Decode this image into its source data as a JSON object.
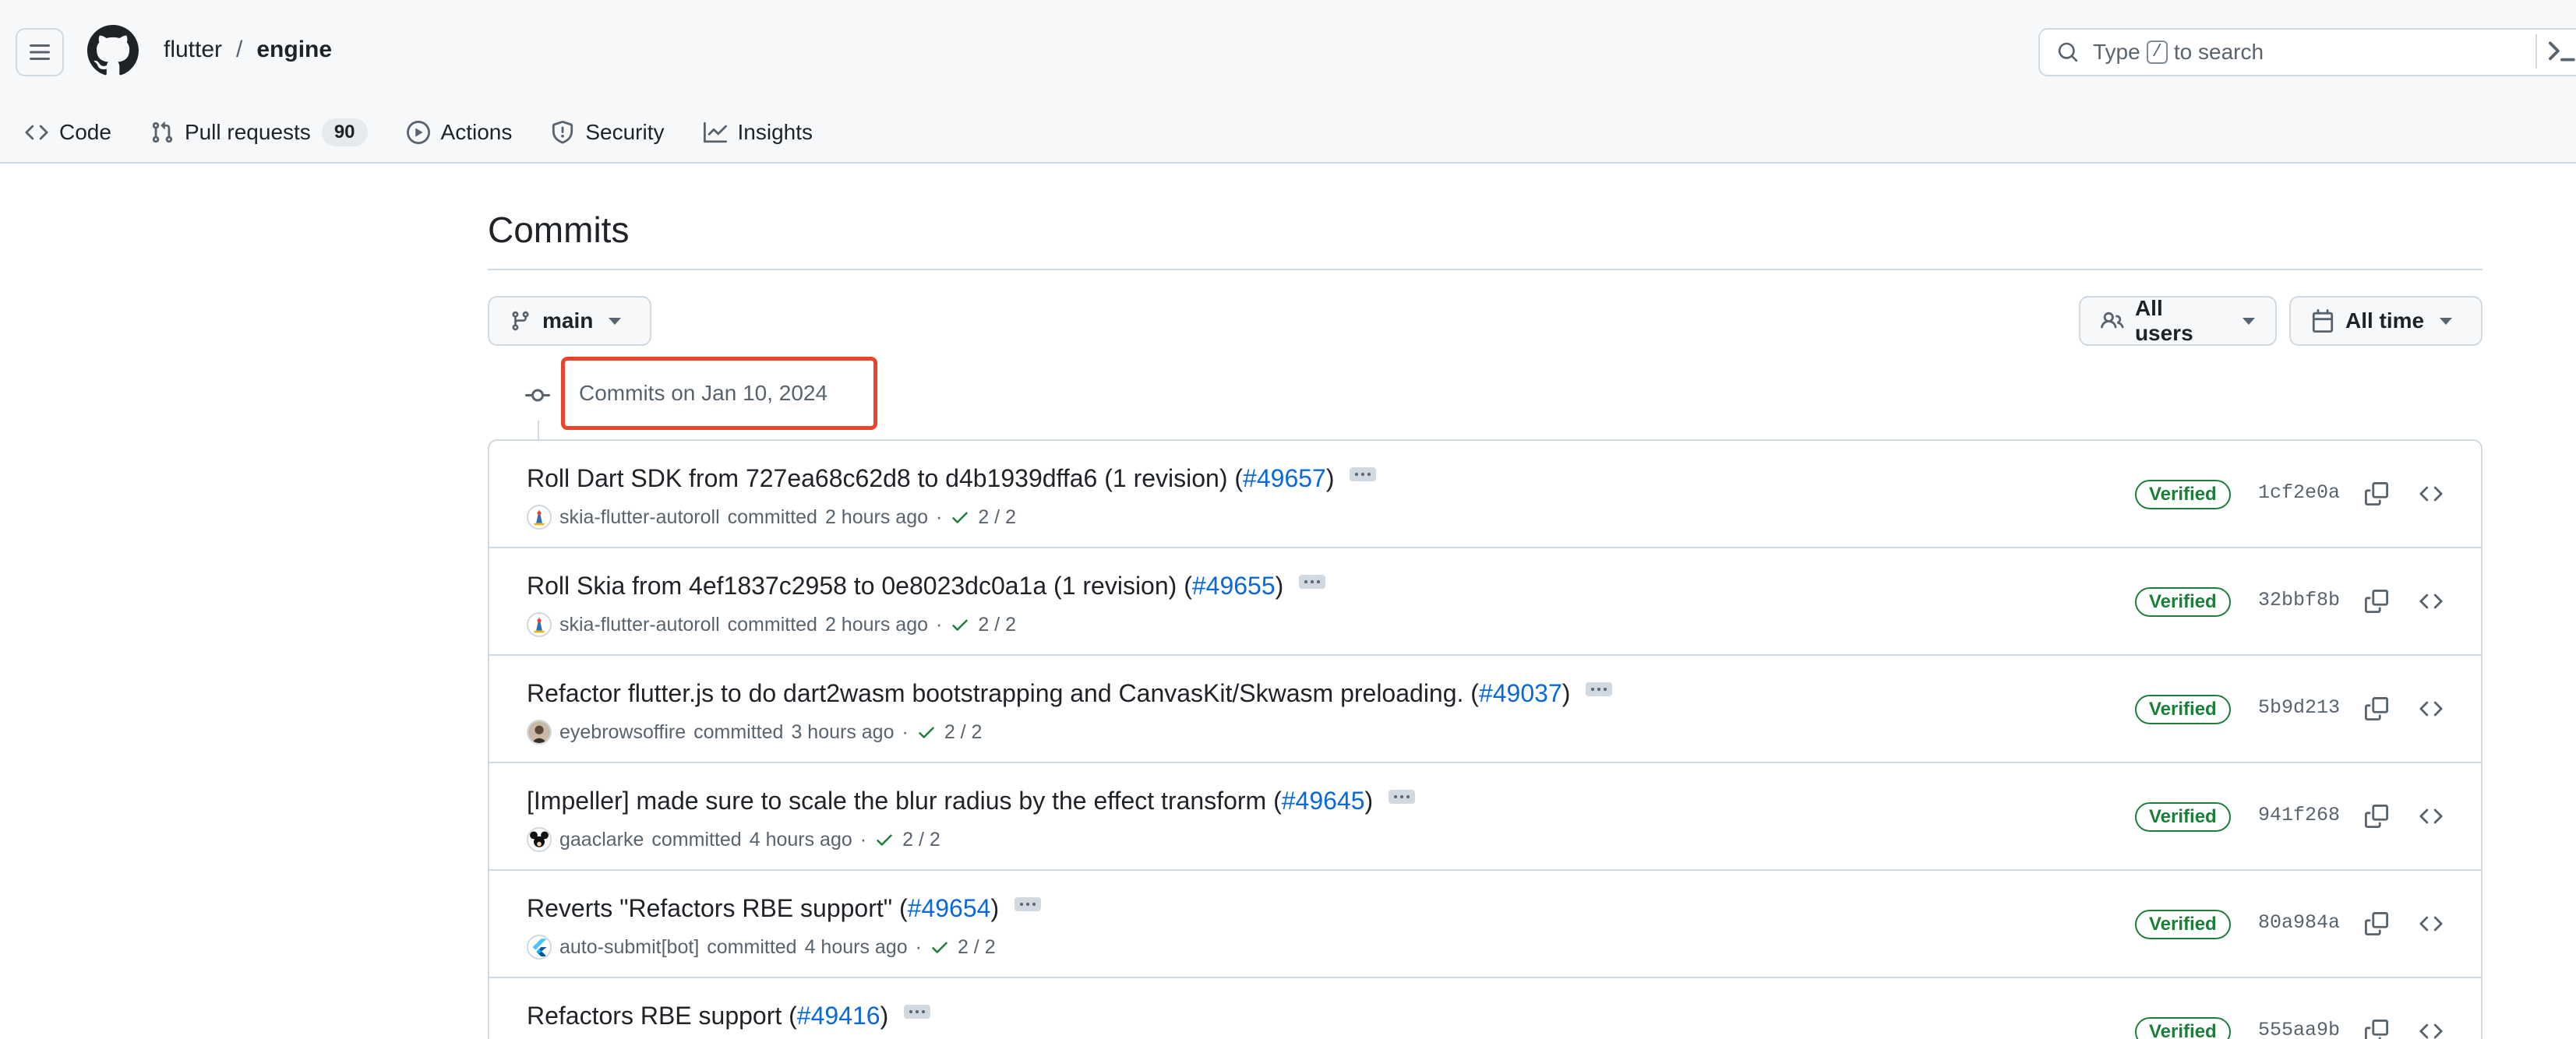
{
  "repo": {
    "owner": "flutter",
    "separator": "/",
    "name": "engine"
  },
  "search": {
    "prefix": "Type",
    "key": "/",
    "suffix": "to search"
  },
  "nav": {
    "code": "Code",
    "pull_requests": "Pull requests",
    "pull_requests_count": "90",
    "actions": "Actions",
    "security": "Security",
    "insights": "Insights"
  },
  "page": {
    "title": "Commits"
  },
  "filters": {
    "branch": "main",
    "users": "All users",
    "time": "All time"
  },
  "group": {
    "header": "Commits on Jan 10, 2024"
  },
  "commits": [
    {
      "title": "Roll Dart SDK from 727ea68c62d8 to d4b1939dffa6 (1 revision) (",
      "pr": "#49657",
      "close": ")",
      "author": "skia-flutter-autoroll",
      "action": "committed",
      "time": "2 hours ago",
      "checks": "2 / 2",
      "verified": "Verified",
      "sha": "1cf2e0a",
      "avatar": "skia"
    },
    {
      "title": "Roll Skia from 4ef1837c2958 to 0e8023dc0a1a (1 revision) (",
      "pr": "#49655",
      "close": ")",
      "author": "skia-flutter-autoroll",
      "action": "committed",
      "time": "2 hours ago",
      "checks": "2 / 2",
      "verified": "Verified",
      "sha": "32bbf8b",
      "avatar": "skia"
    },
    {
      "title": "Refactor flutter.js to do dart2wasm bootstrapping and CanvasKit/Skwasm preloading. (",
      "pr": "#49037",
      "close": ")",
      "author": "eyebrowsoffire",
      "action": "committed",
      "time": "3 hours ago",
      "checks": "2 / 2",
      "verified": "Verified",
      "sha": "5b9d213",
      "avatar": "person"
    },
    {
      "title": "[Impeller] made sure to scale the blur radius by the effect transform (",
      "pr": "#49645",
      "close": ")",
      "author": "gaaclarke",
      "action": "committed",
      "time": "4 hours ago",
      "checks": "2 / 2",
      "verified": "Verified",
      "sha": "941f268",
      "avatar": "mouse"
    },
    {
      "title": "Reverts \"Refactors RBE support\" (",
      "pr": "#49654",
      "close": ")",
      "author": "auto-submit[bot]",
      "action": "committed",
      "time": "4 hours ago",
      "checks": "2 / 2",
      "verified": "Verified",
      "sha": "80a984a",
      "avatar": "flutter"
    },
    {
      "title": "Refactors RBE support (",
      "pr": "#49416",
      "close": ")",
      "author": "",
      "action": "",
      "time": "",
      "checks": "",
      "verified": "Verified",
      "sha": "555aa9b",
      "avatar": "none"
    }
  ],
  "colors": {
    "link": "#0969da",
    "verified": "#1a7f37",
    "highlight": "#e8452c",
    "border": "#d1d9e0"
  }
}
